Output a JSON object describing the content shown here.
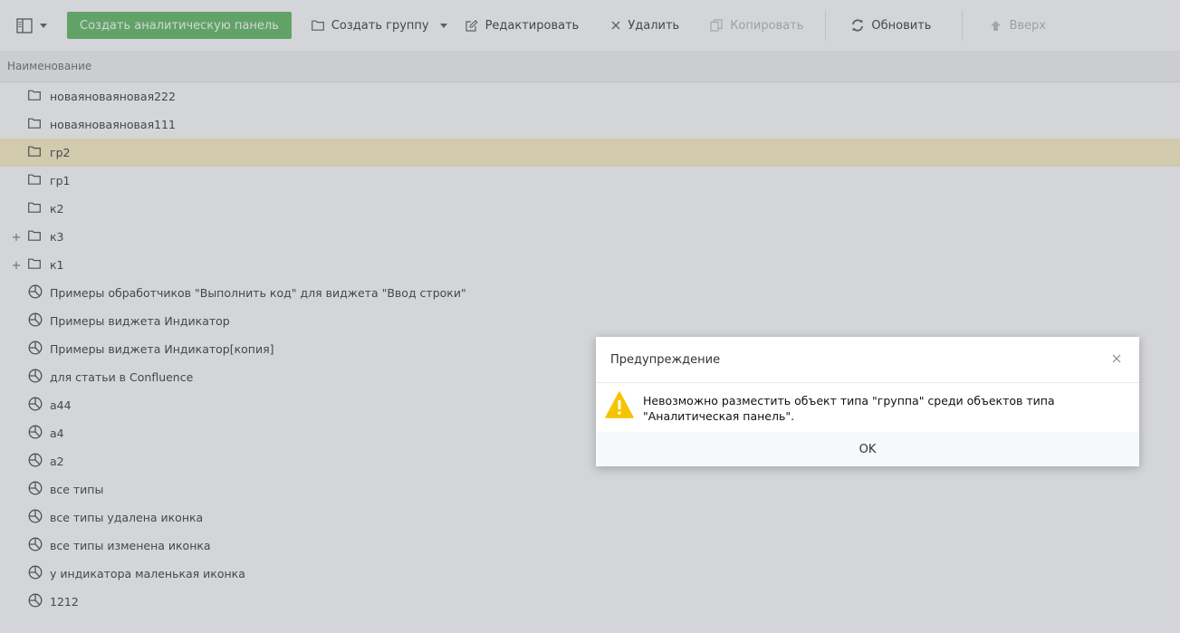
{
  "toolbar": {
    "layout_icon": "sidebar-layout-icon",
    "create_dashboard_label": "Создать аналитическую панель",
    "create_group_label": "Создать группу",
    "edit_label": "Редактировать",
    "delete_label": "Удалить",
    "copy_label": "Копировать",
    "refresh_label": "Обновить",
    "up_label": "Вверх",
    "accent_color": "#5cb85c"
  },
  "table": {
    "column_header": "Наименование"
  },
  "tree": {
    "items": [
      {
        "label": "новаяноваяновая222",
        "icon": "folder-icon",
        "expandable": false,
        "selected": false
      },
      {
        "label": "новаяноваяновая111",
        "icon": "folder-icon",
        "expandable": false,
        "selected": false
      },
      {
        "label": "гр2",
        "icon": "folder-icon",
        "expandable": false,
        "selected": true
      },
      {
        "label": "гр1",
        "icon": "folder-icon",
        "expandable": false,
        "selected": false
      },
      {
        "label": "к2",
        "icon": "folder-icon",
        "expandable": false,
        "selected": false
      },
      {
        "label": "к3",
        "icon": "folder-icon",
        "expandable": true,
        "selected": false
      },
      {
        "label": "к1",
        "icon": "folder-icon",
        "expandable": true,
        "selected": false
      },
      {
        "label": "Примеры обработчиков \"Выполнить код\" для виджета \"Ввод строки\"",
        "icon": "dashboard-icon",
        "expandable": false,
        "selected": false
      },
      {
        "label": "Примеры виджета Индикатор",
        "icon": "dashboard-icon",
        "expandable": false,
        "selected": false
      },
      {
        "label": "Примеры виджета Индикатор[копия]",
        "icon": "dashboard-icon",
        "expandable": false,
        "selected": false
      },
      {
        "label": "для статьи в Confluence",
        "icon": "dashboard-icon",
        "expandable": false,
        "selected": false
      },
      {
        "label": "а44",
        "icon": "dashboard-icon",
        "expandable": false,
        "selected": false
      },
      {
        "label": "а4",
        "icon": "dashboard-icon",
        "expandable": false,
        "selected": false
      },
      {
        "label": "а2",
        "icon": "dashboard-icon",
        "expandable": false,
        "selected": false
      },
      {
        "label": "все типы",
        "icon": "dashboard-icon",
        "expandable": false,
        "selected": false
      },
      {
        "label": "все типы удалена иконка",
        "icon": "dashboard-icon",
        "expandable": false,
        "selected": false
      },
      {
        "label": "все типы изменена иконка",
        "icon": "dashboard-icon",
        "expandable": false,
        "selected": false
      },
      {
        "label": "у индикатора маленькая иконка",
        "icon": "dashboard-icon",
        "expandable": false,
        "selected": false
      },
      {
        "label": "1212",
        "icon": "dashboard-icon",
        "expandable": false,
        "selected": false
      }
    ]
  },
  "dialog": {
    "title": "Предупреждение",
    "message": "Невозможно разместить объект типа \"группа\" среди объектов типа \"Аналитическая панель\".",
    "ok_label": "OK",
    "warning_color": "#f5c400"
  }
}
